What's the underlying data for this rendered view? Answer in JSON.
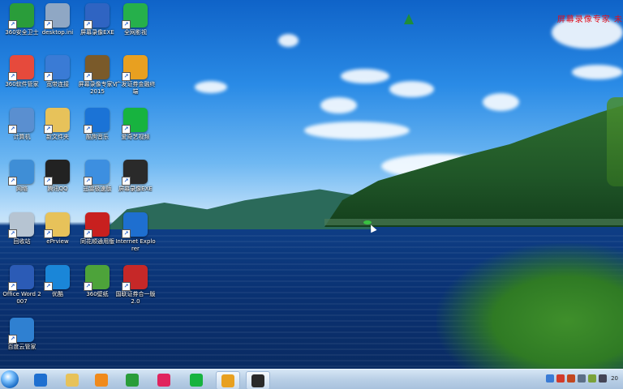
{
  "watermark": {
    "text": "屏幕录像专家 未"
  },
  "desktop_icons": [
    {
      "label": "360安全卫士",
      "icon": "360-safe-icon",
      "color": "#2a9d3a"
    },
    {
      "label": "desktop.ini",
      "icon": "ini-file-icon",
      "color": "#8fa7c4"
    },
    {
      "label": "屏幕录像EXE",
      "icon": "recorder-exe-icon",
      "color": "#2f64c2"
    },
    {
      "label": "全网影视",
      "icon": "video-app-icon",
      "color": "#26b04b"
    },
    {
      "label": "360软件管家",
      "icon": "software-manager-icon",
      "color": "#e64a3c"
    },
    {
      "label": "宽带连接",
      "icon": "network-icon",
      "color": "#3a7bd5"
    },
    {
      "label": "屏幕录像专家V2015",
      "icon": "film-reel-icon",
      "color": "#7a5a2a"
    },
    {
      "label": "广发证券金融终端",
      "icon": "gf-securities-icon",
      "color": "#e8a020"
    },
    {
      "label": "计算机",
      "icon": "computer-icon",
      "color": "#5a8fd0"
    },
    {
      "label": "新文件夹",
      "icon": "folder-icon",
      "color": "#e7c25a"
    },
    {
      "label": "酷狗音乐",
      "icon": "kugou-icon",
      "color": "#1b73d6"
    },
    {
      "label": "爱奇艺视频",
      "icon": "iqiyi-icon",
      "color": "#17b33f"
    },
    {
      "label": "网络",
      "icon": "globe-network-icon",
      "color": "#3f8ed6"
    },
    {
      "label": "腾讯QQ",
      "icon": "qq-penguin-icon",
      "color": "#222222"
    },
    {
      "label": "迅雷极速版",
      "icon": "thunder-icon",
      "color": "#3d8fe0"
    },
    {
      "label": "屏幕录像EXE",
      "icon": "video-thumb-icon",
      "color": "#2a2a2a"
    },
    {
      "label": "回收站",
      "icon": "recycle-bin-icon",
      "color": "#b6c4d2"
    },
    {
      "label": "ePrview",
      "icon": "folder-icon",
      "color": "#e7c25a"
    },
    {
      "label": "同花顺通用版",
      "icon": "tonghuashun-icon",
      "color": "#c8201f"
    },
    {
      "label": "Internet Explorer",
      "icon": "ie-icon",
      "color": "#1e6fd0"
    },
    {
      "label": "Office Word 2007",
      "icon": "word-icon",
      "color": "#2b5bb6"
    },
    {
      "label": "优酷",
      "icon": "youku-icon",
      "color": "#1a86d8"
    },
    {
      "label": "360壁纸",
      "icon": "wallpaper-icon",
      "color": "#4da33a"
    },
    {
      "label": "国联证券合一版2.0",
      "icon": "securities-icon",
      "color": "#c62828"
    },
    {
      "label": "百度云管家",
      "icon": "baidu-cloud-icon",
      "color": "#2f80d1"
    }
  ],
  "taskbar": {
    "start_icon": "windows-start-icon",
    "buttons": [
      {
        "name": "ie-taskbar",
        "icon": "ie-icon",
        "color": "#1e6fd0"
      },
      {
        "name": "explorer-taskbar",
        "icon": "folder-icon",
        "color": "#e7c25a"
      },
      {
        "name": "media-taskbar",
        "icon": "media-player-icon",
        "color": "#f08a1c"
      },
      {
        "name": "360-taskbar",
        "icon": "360-browser-icon",
        "color": "#2a9d3a"
      },
      {
        "name": "app-taskbar",
        "icon": "red-app-icon",
        "color": "#e0245e"
      },
      {
        "name": "iqiyi-taskbar",
        "icon": "iqiyi-icon",
        "color": "#17b33f"
      },
      {
        "name": "gf-taskbar",
        "icon": "gf-securities-icon",
        "color": "#e8a020"
      },
      {
        "name": "recorder-taskbar",
        "icon": "video-thumb-icon",
        "color": "#2a2a2a"
      }
    ],
    "tray_icons": [
      "network-tray-icon",
      "antivirus-tray-icon",
      "flag-tray-icon",
      "speaker-tray-icon",
      "battery-tray-icon",
      "signal-tray-icon"
    ],
    "clock": "20"
  }
}
